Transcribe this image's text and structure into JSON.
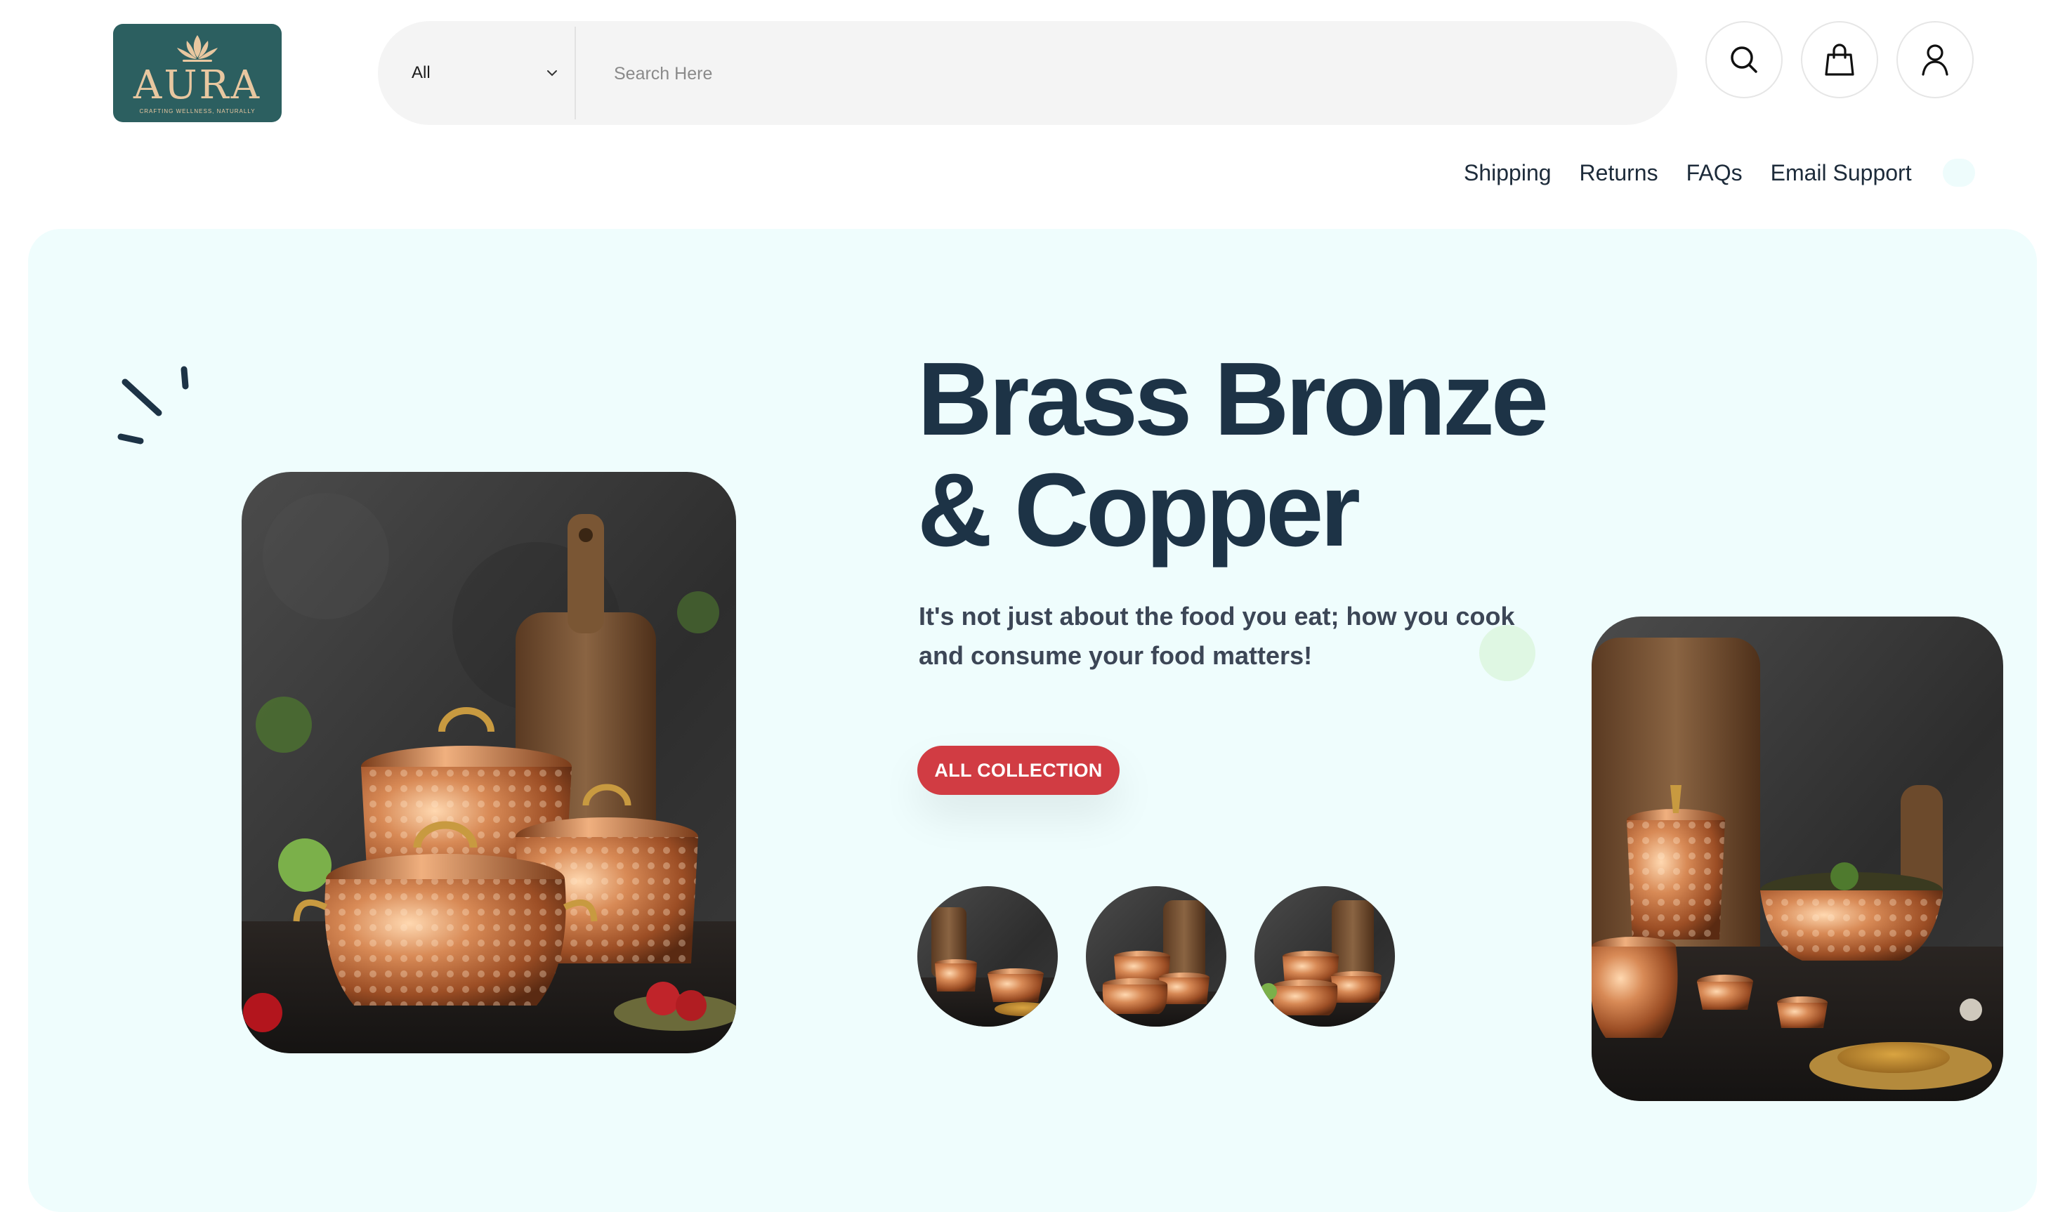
{
  "header": {
    "logo": {
      "brand": "AURA",
      "tagline": "CRAFTING WELLNESS, NATURALLY"
    },
    "search": {
      "category_selected": "All",
      "placeholder": "Search Here",
      "value": ""
    },
    "icons": [
      "search-icon",
      "shopping-bag-icon",
      "user-icon"
    ],
    "nav": {
      "shipping": "Shipping",
      "returns": "Returns",
      "faqs": "FAQs",
      "email_support": "Email Support"
    }
  },
  "hero": {
    "title_line1": "Brass Bronze",
    "title_line2": "& Copper",
    "subtitle": "It's not just about the food you eat; how you cook and consume your food matters!",
    "cta_label": "ALL COLLECTION",
    "thumbnails": [
      "copper-cookware-thumb-1",
      "copper-cookware-thumb-2",
      "copper-cookware-thumb-3"
    ]
  },
  "colors": {
    "brand_teal": "#2c5f60",
    "logo_gold": "#e8c7a0",
    "hero_bg": "#effdfd",
    "heading": "#1d3346",
    "cta_red": "#d13c43",
    "search_bg": "#f4f4f4"
  }
}
